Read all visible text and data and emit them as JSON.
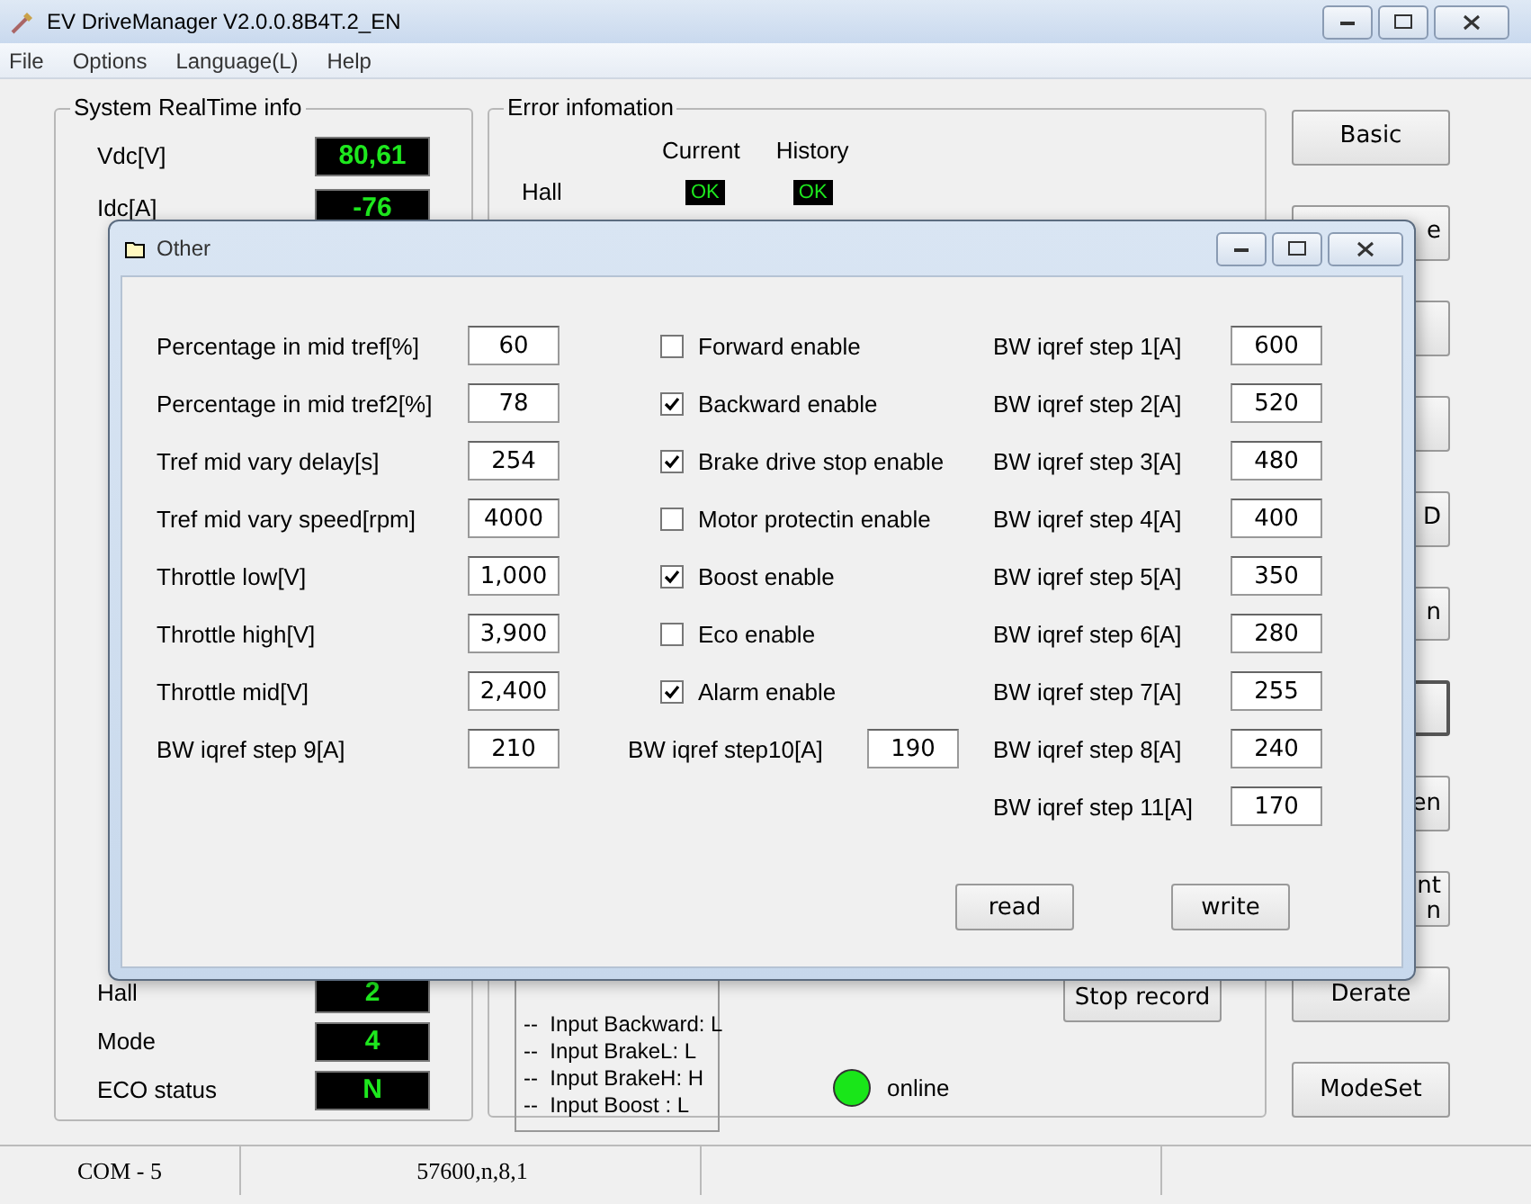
{
  "window": {
    "title": "EV DriveManager V2.0.0.8B4T.2_EN"
  },
  "menu": [
    "File",
    "Options",
    "Language(L)",
    "Help"
  ],
  "realtime": {
    "title": "System RealTime info",
    "top_rows": [
      {
        "label": "Vdc[V]",
        "value": "80,61"
      },
      {
        "label": "Idc[A]",
        "value": "-76"
      }
    ],
    "bottom_rows": [
      {
        "label": "Hall",
        "value": "2"
      },
      {
        "label": "Mode",
        "value": "4"
      },
      {
        "label": "ECO status",
        "value": "N"
      }
    ]
  },
  "error_info": {
    "title": "Error infomation",
    "columns": [
      "Current",
      "History"
    ],
    "rows": [
      {
        "label": "Hall",
        "current": "OK",
        "history": "OK"
      }
    ],
    "inputs": [
      "--  Input Backward: L",
      "--  Input BrakeL: L",
      "--  Input BrakeH: H",
      "--  Input Boost : L"
    ],
    "stop_button": "Stop record",
    "status": {
      "label": "online",
      "on": true
    }
  },
  "side_buttons": [
    {
      "label": "Basic",
      "clipped": false,
      "focused": false
    },
    {
      "label": "e",
      "clipped": true,
      "focused": false
    },
    {
      "focused": false
    },
    {
      "focused": false
    },
    {
      "label": "D",
      "clipped": true,
      "focused": false
    },
    {
      "label": "n",
      "clipped": true,
      "focused": false
    },
    {
      "focused": true
    },
    {
      "label": "en",
      "clipped": true,
      "focused": false
    },
    {
      "label": "nt\nn",
      "clipped": true,
      "focused": false
    },
    {
      "label": "Derate",
      "clipped": false,
      "focused": false
    },
    {
      "label": "ModeSet",
      "clipped": false,
      "focused": false
    }
  ],
  "dialog": {
    "title": "Other",
    "left_fields": [
      {
        "label": "Percentage in mid tref[%]",
        "value": "60"
      },
      {
        "label": "Percentage in mid tref2[%]",
        "value": "78"
      },
      {
        "label": "Tref mid vary delay[s]",
        "value": "254"
      },
      {
        "label": "Tref mid vary speed[rpm]",
        "value": "4000"
      },
      {
        "label": "Throttle low[V]",
        "value": "1,000"
      },
      {
        "label": "Throttle high[V]",
        "value": "3,900"
      },
      {
        "label": "Throttle mid[V]",
        "value": "2,400"
      },
      {
        "label": "BW iqref step 9[A]",
        "value": "210"
      }
    ],
    "checks": [
      {
        "label": "Forward enable",
        "checked": false
      },
      {
        "label": "Backward enable",
        "checked": true
      },
      {
        "label": "Brake drive stop enable",
        "checked": true
      },
      {
        "label": "Motor protectin enable",
        "checked": false
      },
      {
        "label": "Boost enable",
        "checked": true
      },
      {
        "label": "Eco enable",
        "checked": false
      },
      {
        "label": "Alarm enable",
        "checked": true
      }
    ],
    "mid_field": {
      "label": "BW iqref step10[A]",
      "value": "190"
    },
    "right_fields": [
      {
        "label": "BW iqref step 1[A]",
        "value": "600"
      },
      {
        "label": "BW iqref step 2[A]",
        "value": "520"
      },
      {
        "label": "BW iqref step 3[A]",
        "value": "480"
      },
      {
        "label": "BW iqref step 4[A]",
        "value": "400"
      },
      {
        "label": "BW iqref step 5[A]",
        "value": "350"
      },
      {
        "label": "BW iqref step 6[A]",
        "value": "280"
      },
      {
        "label": "BW iqref step 7[A]",
        "value": "255"
      },
      {
        "label": "BW iqref step 8[A]",
        "value": "240"
      },
      {
        "label": "BW iqref step 11[A]",
        "value": "170"
      }
    ],
    "buttons": [
      "read",
      "write"
    ]
  },
  "status_bar": [
    "COM - 5",
    "57600,n,8,1"
  ]
}
